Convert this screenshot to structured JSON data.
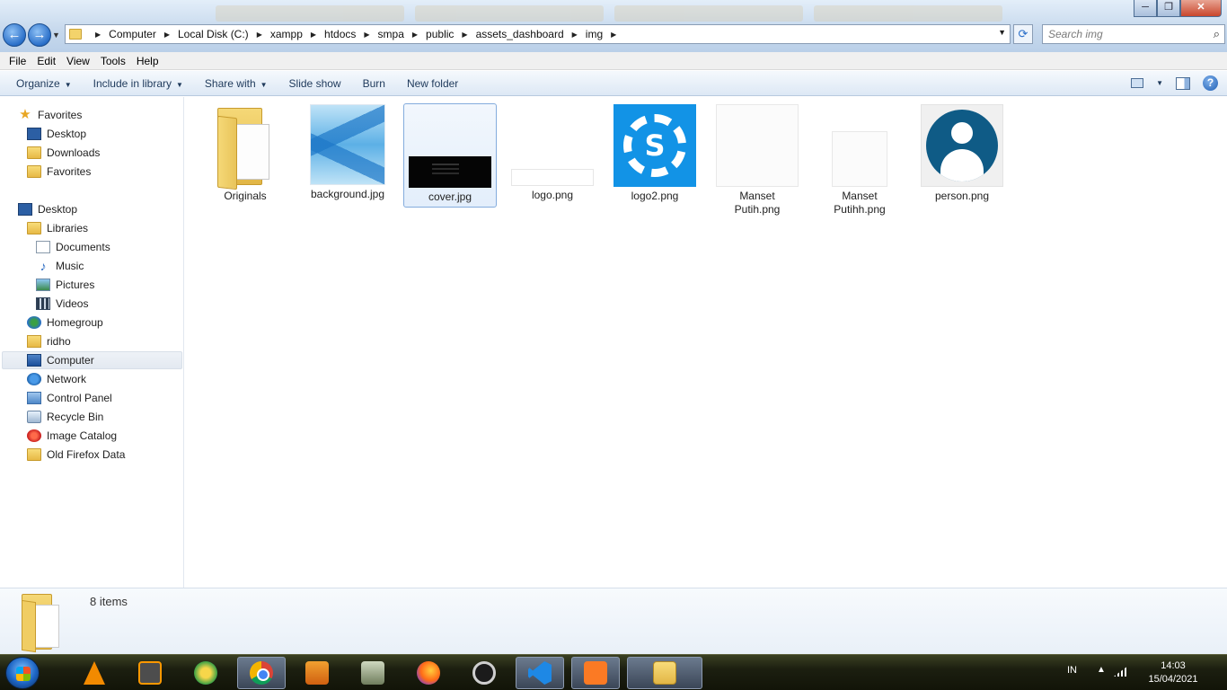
{
  "window": {
    "address_crumbs": [
      "Computer",
      "Local Disk (C:)",
      "xampp",
      "htdocs",
      "smpa",
      "public",
      "assets_dashboard",
      "img"
    ],
    "search_placeholder": "Search img",
    "controls": {
      "minimize": "─",
      "maximize": "❐",
      "close": "✕"
    }
  },
  "menubar": [
    "File",
    "Edit",
    "View",
    "Tools",
    "Help"
  ],
  "commandbar": {
    "organize": "Organize",
    "include_in_library": "Include in library",
    "share_with": "Share with",
    "slide_show": "Slide show",
    "burn": "Burn",
    "new_folder": "New folder"
  },
  "navpane": {
    "favorites": {
      "label": "Favorites",
      "items": [
        "Desktop",
        "Downloads",
        "Favorites"
      ]
    },
    "desktop": {
      "label": "Desktop",
      "items": [
        "Libraries",
        "Documents",
        "Music",
        "Pictures",
        "Videos",
        "Homegroup",
        "ridho",
        "Computer",
        "Network",
        "Control Panel",
        "Recycle Bin",
        "Image Catalog",
        "Old Firefox Data"
      ]
    },
    "selected": "Computer"
  },
  "files": [
    {
      "name": "Originals",
      "kind": "folder"
    },
    {
      "name": "background.jpg",
      "kind": "image"
    },
    {
      "name": "cover.jpg",
      "kind": "image",
      "selected": true
    },
    {
      "name": "logo.png",
      "kind": "image"
    },
    {
      "name": "logo2.png",
      "kind": "image"
    },
    {
      "name": "Manset Putih.png",
      "kind": "image"
    },
    {
      "name": "Manset Putihh.png",
      "kind": "image"
    },
    {
      "name": "person.png",
      "kind": "image"
    }
  ],
  "details": {
    "count": "8 items"
  },
  "taskbar": {
    "apps": [
      "vlc-icon",
      "sublime-text-icon",
      "map-app-icon",
      "chrome-icon",
      "media-player-icon",
      "system-monitor-icon",
      "firefox-icon",
      "obs-icon",
      "vscode-icon",
      "xampp-icon",
      "windows-explorer-icon"
    ],
    "active_app": "windows-explorer-icon",
    "tray": {
      "language": "IN",
      "time": "14:03",
      "date": "15/04/2021"
    }
  }
}
